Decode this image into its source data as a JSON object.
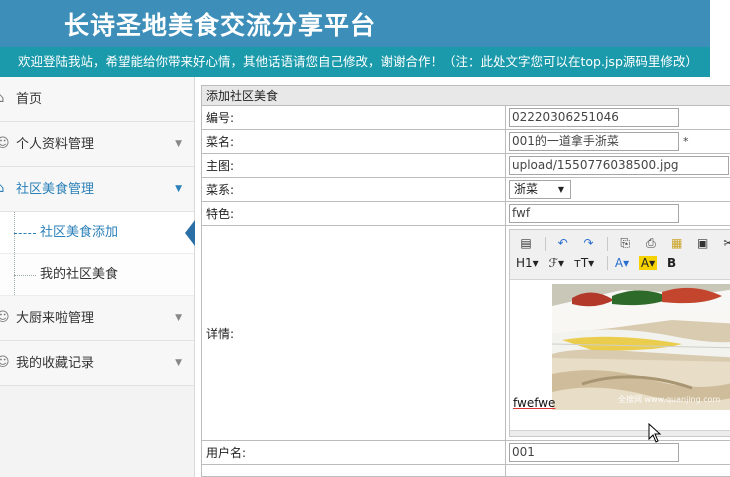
{
  "header": {
    "title": "长诗圣地美食交流分享平台",
    "marquee": "欢迎登陆我站，希望能给你带来好心情，其他话语请您自己修改，谢谢合作！（注：此处文字您可以在top.jsp源码里修改）"
  },
  "sidebar": {
    "items": [
      {
        "label": "首页",
        "icon": "home-icon"
      },
      {
        "label": "个人资料管理",
        "icon": "user-icon"
      },
      {
        "label": "社区美食管理",
        "icon": "home-icon"
      },
      {
        "label": "大厨来啦管理",
        "icon": "user-icon"
      },
      {
        "label": "我的收藏记录",
        "icon": "user-icon"
      }
    ],
    "subitems": [
      {
        "label": "社区美食添加"
      },
      {
        "label": "我的社区美食"
      }
    ]
  },
  "form": {
    "caption": "添加社区美食",
    "fields": [
      {
        "label": "编号:",
        "value": "02220306251046"
      },
      {
        "label": "菜名:",
        "value": "001的一道拿手浙菜",
        "required": "*"
      },
      {
        "label": "主图:",
        "value": "upload/1550776038500.jpg"
      },
      {
        "label": "菜系:",
        "value": "浙菜"
      },
      {
        "label": "特色:",
        "value": "fwf"
      },
      {
        "label": "详情:",
        "value": ""
      },
      {
        "label": "用户名:",
        "value": "001"
      }
    ],
    "editor": {
      "text": "fwefwe",
      "toolbar_row2": [
        "H1",
        "ℱ",
        "тT",
        "A",
        "A",
        "B"
      ],
      "watermark": "全搜网 www.quanjing.com"
    }
  },
  "colors": {
    "header_bg": "#3d8fb9",
    "marquee_bg": "#1a9aab",
    "sidebar_bg": "#f3f3f3",
    "accent": "#2a80b9"
  }
}
